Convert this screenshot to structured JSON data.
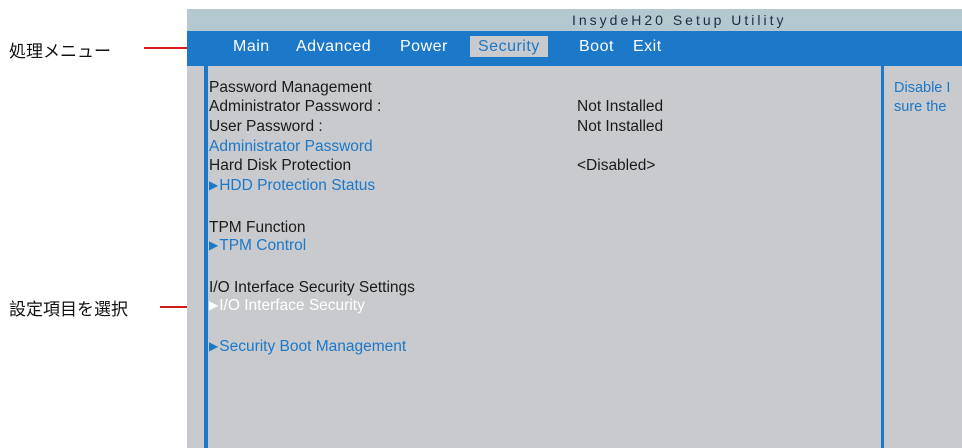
{
  "title": "InsydeH20 Setup Utility",
  "menu": {
    "items": [
      "Main",
      "Advanced",
      "Power",
      "Security",
      "Boot",
      "Exit"
    ],
    "active": "Security"
  },
  "settings": {
    "password_management": "Password Management",
    "admin_password_label": "Administrator Password :",
    "admin_password_value": "Not Installed",
    "user_password_label": "User Password :",
    "user_password_value": "Not Installed",
    "admin_password_link": "Administrator Password",
    "hdd_protection_label": "Hard Disk Protection",
    "hdd_protection_value": "<Disabled>",
    "hdd_status_link": "HDD Protection Status",
    "tpm_function": "TPM Function",
    "tpm_control_link": "TPM Control",
    "io_settings_label": "I/O Interface Security Settings",
    "io_security_link": "I/O Interface Security",
    "secure_boot_link": "Security Boot Management"
  },
  "help": {
    "line1": "Disable I",
    "line2": "sure the"
  },
  "annotations": {
    "menu_callout": "処理メニュー",
    "select_callout": "設定項目を選択"
  },
  "colors": {
    "accent_blue": "#1c78c9",
    "panel_gray": "#c8cacd",
    "title_bar": "#b4c9cf",
    "callout_red": "#d21a1a"
  },
  "icons": {
    "submenu_marker": "triangle-right-icon"
  }
}
